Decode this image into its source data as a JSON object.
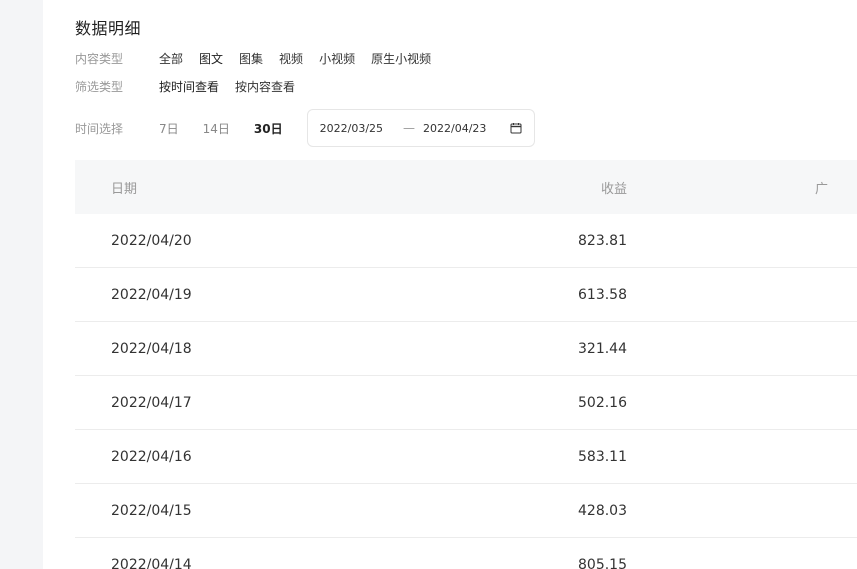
{
  "page": {
    "title": "数据明细"
  },
  "filters": {
    "content_type": {
      "label": "内容类型",
      "options": [
        "全部",
        "图文",
        "图集",
        "视频",
        "小视频",
        "原生小视频"
      ]
    },
    "filter_type": {
      "label": "筛选类型",
      "options": [
        "按时间查看",
        "按内容查看"
      ]
    },
    "time": {
      "label": "时间选择",
      "options": [
        "7日",
        "14日",
        "30日"
      ],
      "selected": "30日",
      "range_start": "2022/03/25",
      "range_separator": "—",
      "range_end": "2022/04/23",
      "icon": "calendar-icon"
    }
  },
  "table": {
    "headers": [
      "日期",
      "收益",
      "广"
    ],
    "rows": [
      {
        "date": "2022/04/20",
        "revenue": "823.81"
      },
      {
        "date": "2022/04/19",
        "revenue": "613.58"
      },
      {
        "date": "2022/04/18",
        "revenue": "321.44"
      },
      {
        "date": "2022/04/17",
        "revenue": "502.16"
      },
      {
        "date": "2022/04/16",
        "revenue": "583.11"
      },
      {
        "date": "2022/04/15",
        "revenue": "428.03"
      },
      {
        "date": "2022/04/14",
        "revenue": "805.15"
      }
    ]
  }
}
